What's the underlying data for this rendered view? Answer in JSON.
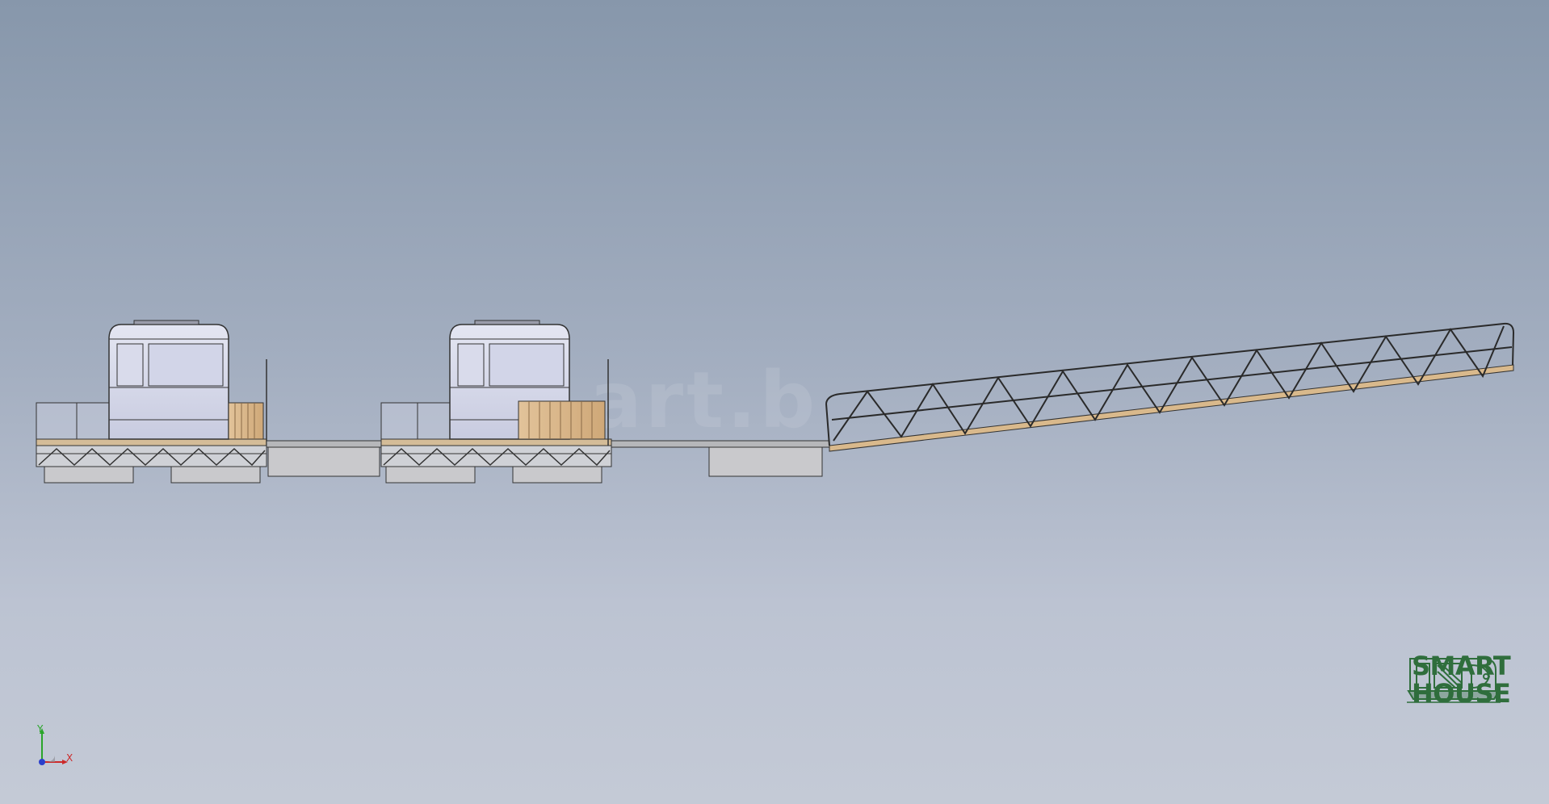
{
  "scene": {
    "watermark": "art.b",
    "background_top": "#8797ab",
    "background_bottom": "#c4cad6"
  },
  "triad": {
    "x_label": "X",
    "y_label": "Y",
    "x_color": "#cc2a2a",
    "y_color": "#2aa52a",
    "z_color": "#2a3fcc"
  },
  "logo": {
    "line1": "SMART",
    "line2": "HOUSE",
    "color": "#2f6e3c"
  }
}
